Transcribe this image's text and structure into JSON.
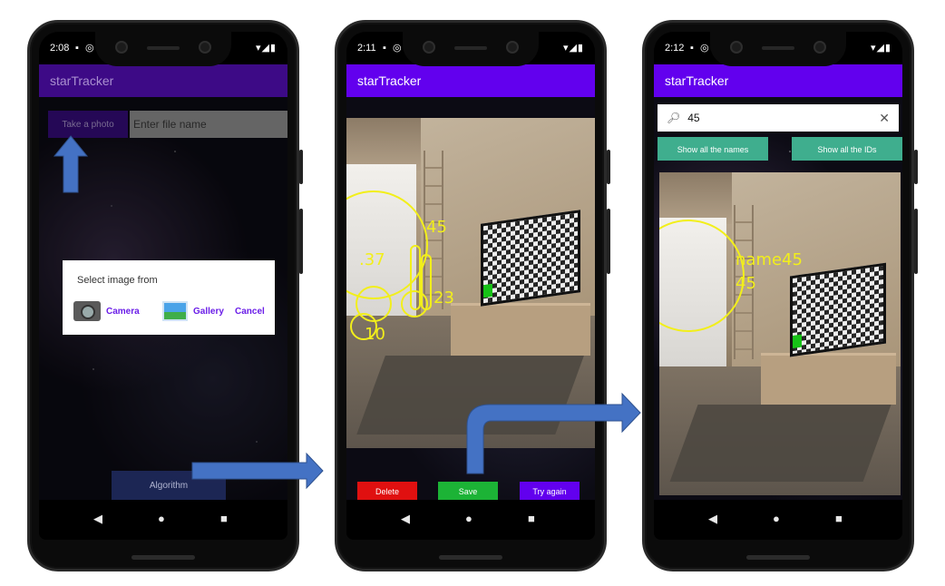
{
  "colors": {
    "app_bar_dim": "#3d0a86",
    "app_bar": "#6200ee",
    "delete": "#e01010",
    "save": "#1cb336",
    "try_again": "#6200ee",
    "show_buttons": "#3fae8e",
    "detection": "#f2ef1a",
    "arrow": "#4472c4"
  },
  "phone1": {
    "status_time": "2:08",
    "app_title": "starTracker",
    "take_photo_label": "Take a photo",
    "file_name_placeholder": "Enter file name",
    "dialog": {
      "title": "Select image from",
      "camera_label": "Camera",
      "gallery_label": "Gallery",
      "cancel_label": "Cancel",
      "camera_icon": "camera-icon",
      "gallery_icon": "gallery-icon"
    },
    "algorithm_label": "Algorithm"
  },
  "phone2": {
    "status_time": "2:11",
    "app_title": "starTracker",
    "detections": [
      {
        "text": "45"
      },
      {
        "text": ".37"
      },
      {
        "text": "23"
      },
      {
        "text": "10"
      }
    ],
    "delete_label": "Delete",
    "save_label": "Save",
    "try_again_label": "Try again"
  },
  "phone3": {
    "status_time": "2:12",
    "app_title": "starTracker",
    "search_value": "45",
    "search_icon": "search-icon",
    "clear_icon": "close-icon",
    "show_names_label": "Show all the names",
    "show_ids_label": "Show all the IDs",
    "detection_name": "name45",
    "detection_id": "45"
  },
  "nav_icons": [
    "back-icon",
    "home-icon",
    "recents-icon"
  ]
}
